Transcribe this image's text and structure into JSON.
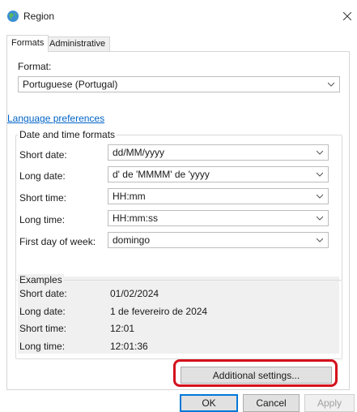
{
  "window": {
    "title": "Region"
  },
  "tabs": [
    {
      "label": "Formats",
      "active": true
    },
    {
      "label": "Administrative",
      "active": false
    }
  ],
  "format": {
    "label": "Format:",
    "value": "Portuguese (Portugal)"
  },
  "language_link": "Language preferences",
  "date_time_formats": {
    "title": "Date and time formats",
    "rows": [
      {
        "label": "Short date:",
        "value": "dd/MM/yyyy"
      },
      {
        "label": "Long date:",
        "value": "d' de 'MMMM' de 'yyyy"
      },
      {
        "label": "Short time:",
        "value": "HH:mm"
      },
      {
        "label": "Long time:",
        "value": "HH:mm:ss"
      },
      {
        "label": "First day of week:",
        "value": "domingo"
      }
    ]
  },
  "examples": {
    "title": "Examples",
    "rows": [
      {
        "label": "Short date:",
        "value": "01/02/2024"
      },
      {
        "label": "Long date:",
        "value": "1 de fevereiro de 2024"
      },
      {
        "label": "Short time:",
        "value": "12:01"
      },
      {
        "label": "Long time:",
        "value": "12:01:36"
      }
    ]
  },
  "buttons": {
    "additional_settings": "Additional settings...",
    "ok": "OK",
    "cancel": "Cancel",
    "apply": "Apply"
  },
  "colors": {
    "highlight": "#d4111c",
    "link": "#0064c8",
    "accent": "#0078d7"
  }
}
